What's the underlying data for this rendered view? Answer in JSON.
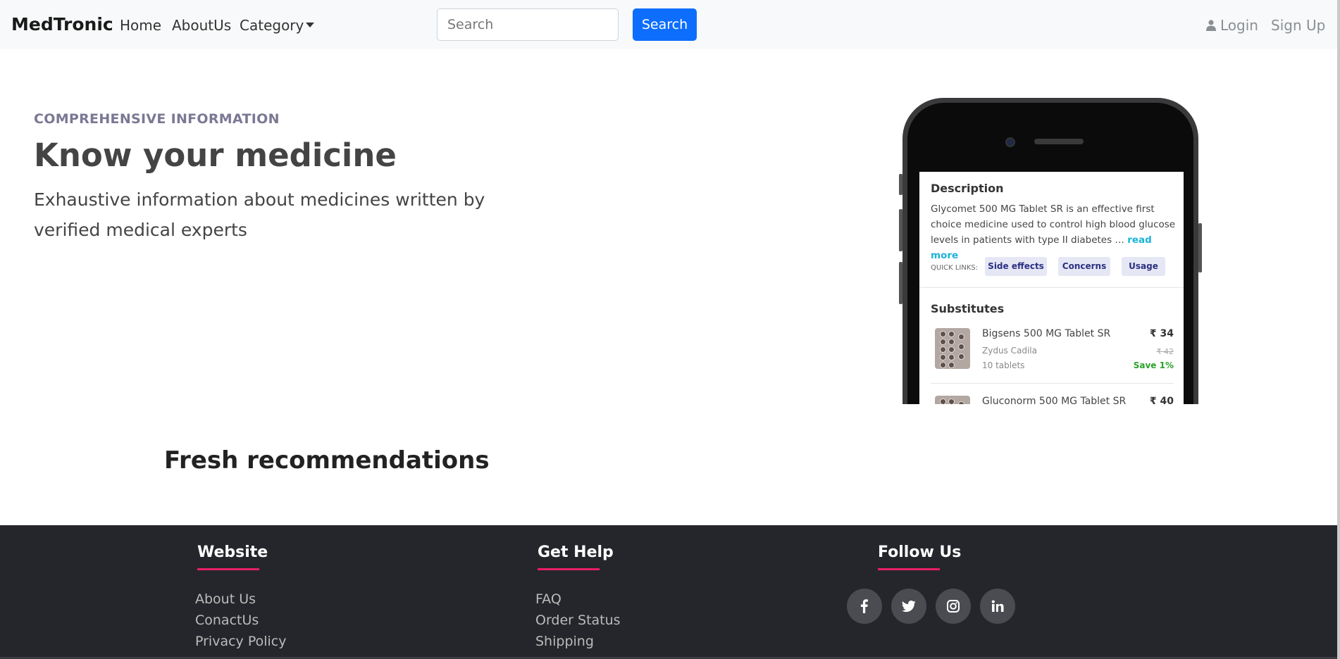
{
  "navbar": {
    "brand": "MedTronic",
    "links": [
      "Home",
      "AboutUs",
      "Category"
    ],
    "search_placeholder": "Search",
    "search_button": "Search",
    "login": "Login",
    "signup": "Sign Up"
  },
  "hero": {
    "eyebrow": "COMPREHENSIVE INFORMATION",
    "title": "Know your medicine",
    "subtitle": "Exhaustive information about medicines written by verified medical experts"
  },
  "phone": {
    "description_heading": "Description",
    "description_text": "Glycomet 500 MG Tablet SR is an effective first choice medicine used to control high blood glucose levels in patients with type II diabetes …",
    "read_more": "read more",
    "quick_links_label": "QUICK LINKS:",
    "quick_links": [
      "Side effects",
      "Concerns",
      "Usage"
    ],
    "substitutes_heading": "Substitutes",
    "substitutes": [
      {
        "name": "Bigsens 500 MG Tablet SR",
        "manufacturer": "Zydus Cadila",
        "quantity": "10 tablets",
        "price": "₹ 34",
        "mrp": "₹ 42",
        "save": "Save 1%"
      },
      {
        "name": "Gluconorm 500 MG Tablet SR",
        "price": "₹ 40"
      }
    ]
  },
  "recommendations": {
    "title": "Fresh recommendations"
  },
  "footer": {
    "columns": [
      {
        "heading": "Website",
        "links": [
          "About Us",
          "ConactUs",
          "Privacy Policy"
        ]
      },
      {
        "heading": "Get Help",
        "links": [
          "FAQ",
          "Order Status",
          "Shipping"
        ]
      },
      {
        "heading": "Follow Us",
        "links": []
      }
    ],
    "social_icons": [
      "facebook-icon",
      "twitter-icon",
      "instagram-icon",
      "linkedin-icon"
    ]
  },
  "colors": {
    "primary": "#0d6efd",
    "navbar_bg": "#f8f9fa",
    "footer_bg": "#24262b",
    "footer_accent": "#e91e63",
    "eyebrow": "#7a7894",
    "read_more": "#1ab3d8",
    "save_green": "#2aa12a"
  }
}
